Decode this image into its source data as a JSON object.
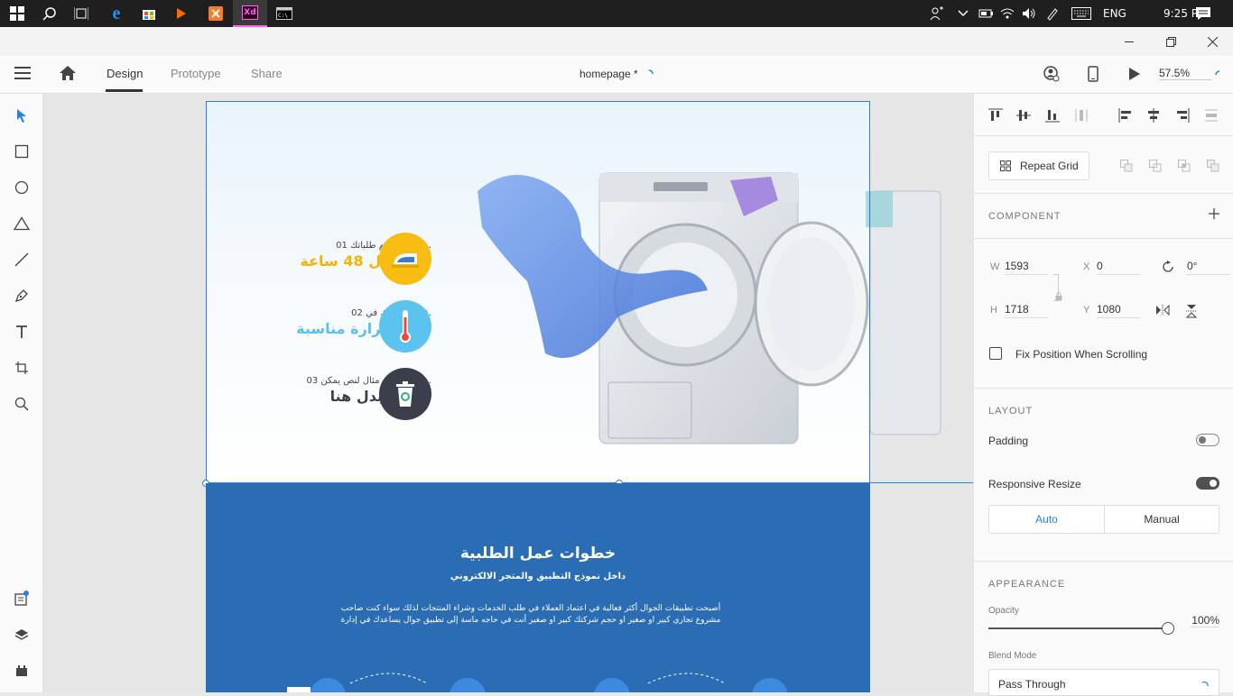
{
  "taskbar": {
    "tray": {
      "lang": "ENG",
      "time": "9:25 PM"
    },
    "xd_label": "Xd"
  },
  "appbar": {
    "tabs": [
      "Design",
      "Prototype",
      "Share"
    ],
    "doc_title": "homepage *",
    "zoom": "57.5%"
  },
  "artboard": {
    "features": [
      {
        "num": "01.",
        "text": "يمكنك استلام طلباتك",
        "title": "في خلال 48 ساعة",
        "color": "#f5b400"
      },
      {
        "num": "02.",
        "text": "غسل طلباتك في",
        "title": "درجة حرارة مناسبة",
        "color": "#5cc0ec"
      },
      {
        "num": "03.",
        "text": "هذا النص هو مثال لنص يمكن",
        "title": "أن يستبدل هنا",
        "color": "#3a3f4b"
      }
    ],
    "blue": {
      "heading": "خطوات عمل الطلبية",
      "subheading": "داخل نموذج التطبيق والمتجر الالكتروني",
      "para1": "أصبحت تطبيقات الجوال أكثر فعالية في اعتماد العملاء في طلب الخدمات وشراء المنتجات لذلك سواء كنت صاحب",
      "para2": "مشروع تجاري كبير او صغير او حجم شركتك كبير او صغير أنت في حاجه ماسة إلى تطبيق جوال يساعدك في إدارة"
    }
  },
  "panel": {
    "repeat_grid": "Repeat Grid",
    "component": "COMPONENT",
    "w_label": "W",
    "w": "1593",
    "x_label": "X",
    "x": "0",
    "rot": "0°",
    "h_label": "H",
    "h": "1718",
    "y_label": "Y",
    "y": "1080",
    "fix_position": "Fix Position When Scrolling",
    "layout": "LAYOUT",
    "padding": "Padding",
    "responsive_resize": "Responsive Resize",
    "auto": "Auto",
    "manual": "Manual",
    "appearance": "APPEARANCE",
    "opacity_label": "Opacity",
    "opacity": "100%",
    "blend_label": "Blend Mode",
    "blend": "Pass Through"
  },
  "colors": {
    "accent": "#2680eb",
    "artboard_blue": "#2b6db5"
  }
}
